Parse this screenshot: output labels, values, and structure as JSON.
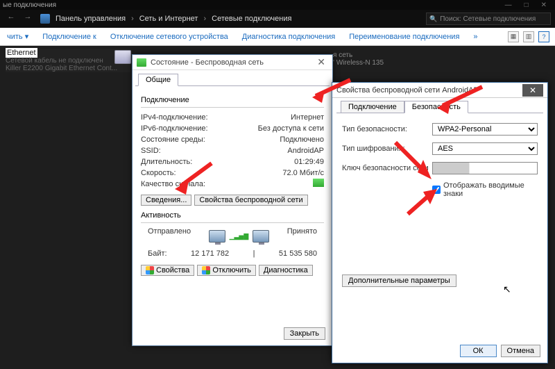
{
  "top_title": "ые подключения",
  "top_buttons": {
    "min": "—",
    "max": "□",
    "close": "✕"
  },
  "breadcrumb": {
    "back": "←",
    "fwd": "→",
    "items": [
      "Панель управления",
      "Сеть и Интернет",
      "Сетевые подключения"
    ],
    "search_placeholder": "Поиск: Сетевые подключения"
  },
  "cmdbar": {
    "links": [
      "чить ▾",
      "Подключение к",
      "Отключение сетевого устройства",
      "Диагностика подключения",
      "Переименование подключения"
    ],
    "chevron": "»"
  },
  "eth": {
    "title": "Ethernet",
    "sub1": "Сетевой кабель не подключен",
    "sub2": "Killer E2200 Gigabit Ethernet Cont..."
  },
  "bg_item": {
    "l1": "я сеть",
    "l2": "' Wireless-N 135"
  },
  "dlg1": {
    "title": "Состояние - Беспроводная сеть",
    "tab": "Общие",
    "conn_title": "Подключение",
    "kv": [
      {
        "k": "IPv4-подключение:",
        "v": "Интернет"
      },
      {
        "k": "IPv6-подключение:",
        "v": "Без доступа к сети"
      },
      {
        "k": "Состояние среды:",
        "v": "Подключено"
      },
      {
        "k": "SSID:",
        "v": "AndroidAP"
      },
      {
        "k": "Длительность:",
        "v": "01:29:49"
      },
      {
        "k": "Скорость:",
        "v": "72.0 Мбит/с"
      },
      {
        "k": "Качество сигнала:",
        "v": ""
      }
    ],
    "btn_details": "Сведения...",
    "btn_props": "Свойства беспроводной сети",
    "activity_title": "Активность",
    "sent": "Отправлено",
    "recv": "Принято",
    "bytes_label": "Байт:",
    "bytes_sent": "12 171 782",
    "bytes_recv": "51 535 580",
    "btn_p": "Свойства",
    "btn_d": "Отключить",
    "btn_g": "Диагностика",
    "close_btn": "Закрыть"
  },
  "dlg2": {
    "title": "Свойства беспроводной сети AndroidAP",
    "tab1": "Подключение",
    "tab2": "Безопасность",
    "sec_type_l": "Тип безопасности:",
    "sec_type_v": "WPA2-Personal",
    "enc_l": "Тип шифрования:",
    "enc_v": "AES",
    "key_l": "Ключ безопасности сети",
    "show_l": "Отображать вводимые знаки",
    "adv": "Дополнительные параметры",
    "ok": "ОК",
    "cancel": "Отмена"
  }
}
